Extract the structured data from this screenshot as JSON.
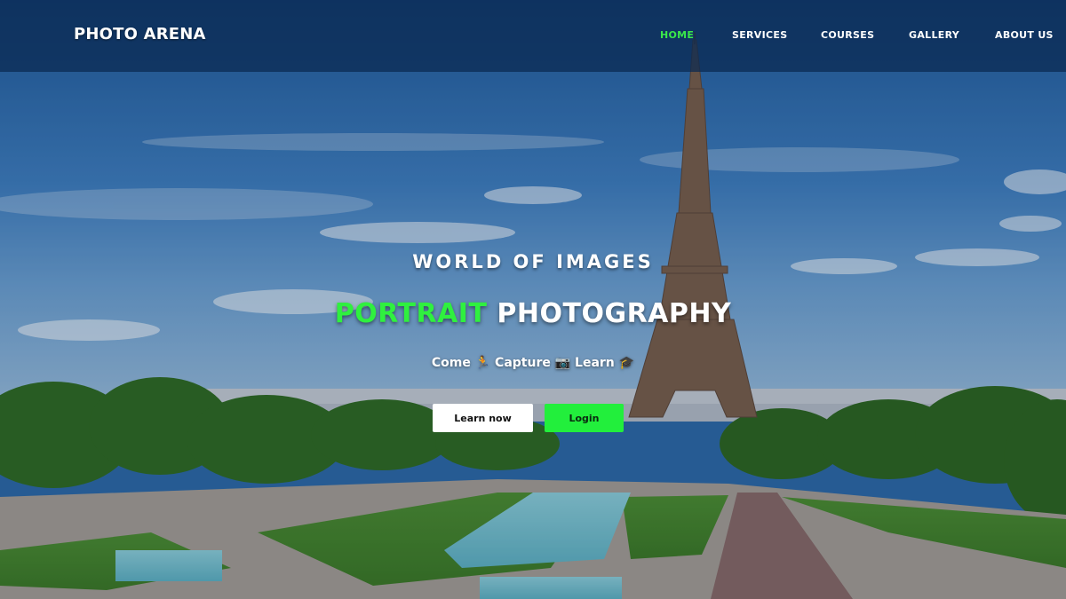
{
  "brand": "PHOTO ARENA",
  "nav": {
    "items": [
      {
        "label": "HOME",
        "active": true
      },
      {
        "label": "SERVICES",
        "active": false
      },
      {
        "label": "COURSES",
        "active": false
      },
      {
        "label": "GALLERY",
        "active": false
      },
      {
        "label": "ABOUT US",
        "active": false
      }
    ]
  },
  "hero": {
    "subtitle": "WORLD OF IMAGES",
    "title_accent": "PORTRAIT",
    "title_rest": "PHOTOGRAPHY",
    "tagline": "Come 🏃 Capture 📷 Learn 🎓"
  },
  "buttons": {
    "learn_label": "Learn now",
    "login_label": "Login"
  },
  "colors": {
    "accent": "#2ff03f",
    "nav_bg": "#0a2850",
    "button_primary": "#22ef3c",
    "button_secondary": "#ffffff"
  }
}
